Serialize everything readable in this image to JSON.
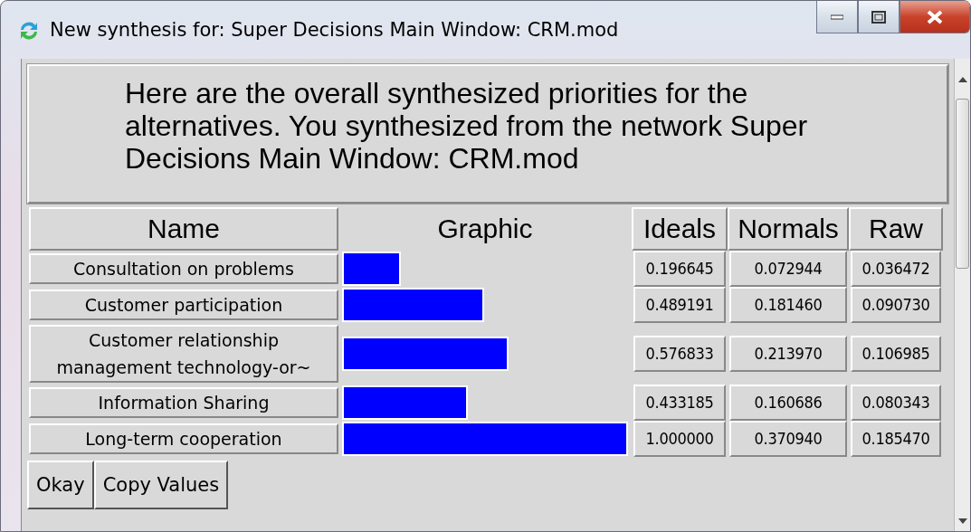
{
  "window": {
    "title": "New synthesis for: Super Decisions Main Window: CRM.mod"
  },
  "message": "Here are the overall synthesized priorities for the alternatives.  You synthesized from the network Super Decisions Main Window: CRM.mod",
  "table": {
    "columns": [
      "Name",
      "Graphic",
      "Ideals",
      "Normals",
      "Raw"
    ],
    "rows": [
      {
        "name": "Consultation on problems",
        "level": 0.196645,
        "ideals": "0.196645",
        "normals": "0.072944",
        "raw": "0.036472"
      },
      {
        "name": "Customer participation",
        "level": 0.489191,
        "ideals": "0.489191",
        "normals": "0.181460",
        "raw": "0.090730"
      },
      {
        "name": "Customer relationship management technology-or~",
        "level": 0.576833,
        "ideals": "0.576833",
        "normals": "0.213970",
        "raw": "0.106985"
      },
      {
        "name": "Information Sharing",
        "level": 0.433185,
        "ideals": "0.433185",
        "normals": "0.160686",
        "raw": "0.080343"
      },
      {
        "name": "Long-term cooperation",
        "level": 1.0,
        "ideals": "1.000000",
        "normals": "0.370940",
        "raw": "0.185470"
      }
    ]
  },
  "buttons": [
    "Okay",
    "Copy Values"
  ]
}
